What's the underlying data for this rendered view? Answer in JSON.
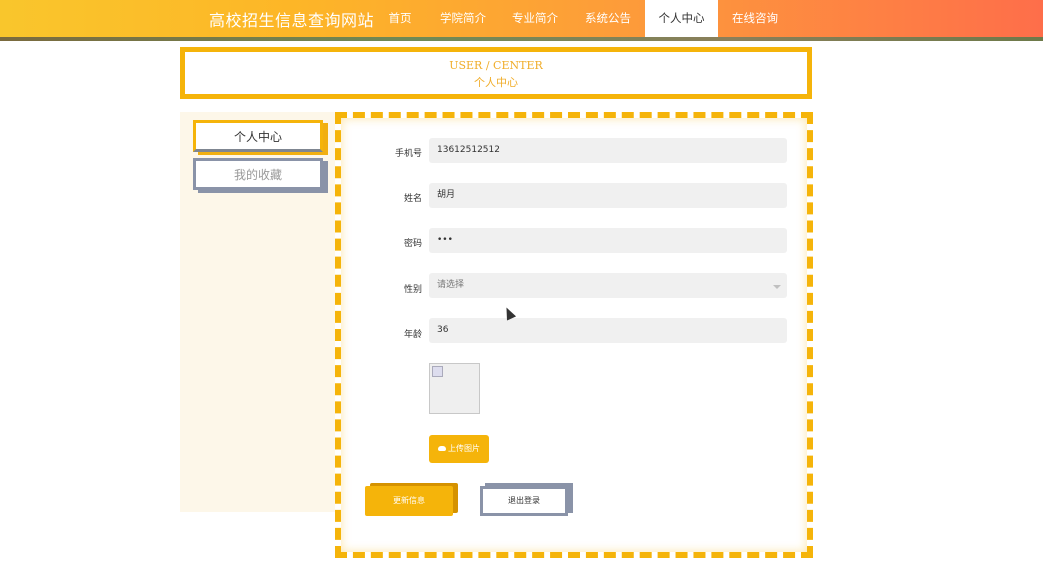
{
  "nav": {
    "brand": "高校招生信息查询网站",
    "items": [
      {
        "label": "首页",
        "active": false
      },
      {
        "label": "学院简介",
        "active": false
      },
      {
        "label": "专业简介",
        "active": false
      },
      {
        "label": "系统公告",
        "active": false
      },
      {
        "label": "个人中心",
        "active": true
      },
      {
        "label": "在线咨询",
        "active": false
      }
    ]
  },
  "banner": {
    "title_en": "USER / CENTER",
    "title_cn": "个人中心"
  },
  "sidebar": {
    "items": [
      {
        "label": "个人中心",
        "active": true
      },
      {
        "label": "我的收藏",
        "active": false
      }
    ]
  },
  "form": {
    "phone": {
      "label": "手机号",
      "value": "13612512512"
    },
    "name": {
      "label": "姓名",
      "value": "胡月"
    },
    "password": {
      "label": "密码",
      "value": "•••"
    },
    "gender": {
      "label": "性别",
      "value": "请选择"
    },
    "age": {
      "label": "年龄",
      "value": "36"
    },
    "upload_label": "上传图片"
  },
  "actions": {
    "update_label": "更新信息",
    "logout_label": "退出登录"
  },
  "colors": {
    "accent": "#f5b40a",
    "secondary": "#8a93a8"
  }
}
